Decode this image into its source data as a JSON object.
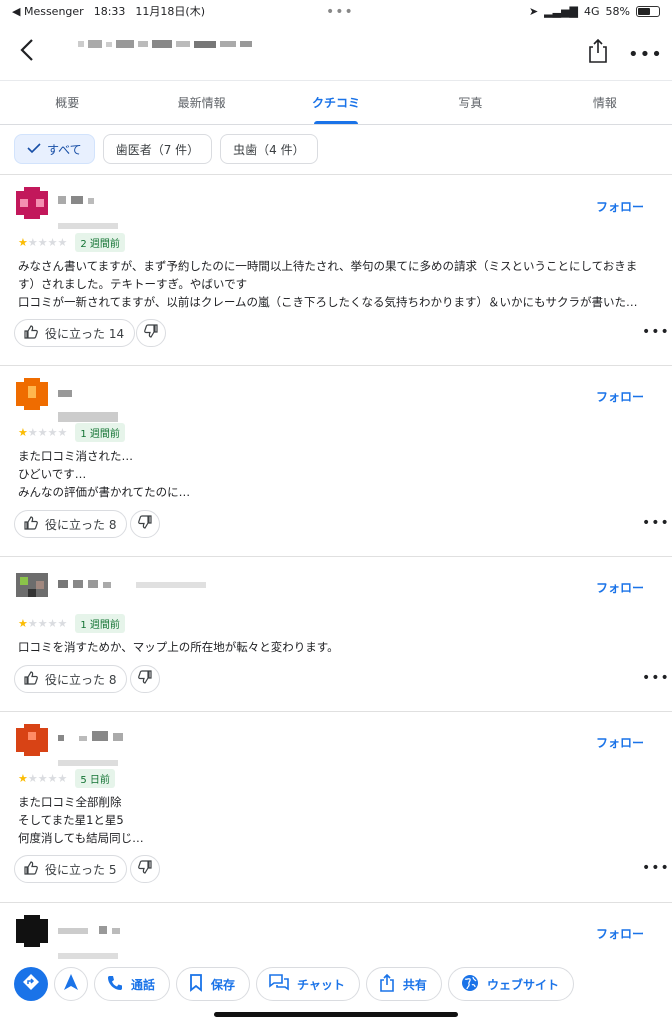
{
  "status_bar": {
    "back_app": "◀ Messenger",
    "time": "18:33",
    "date": "11月18日(木)",
    "center_dots": "•••",
    "network": "4G",
    "battery": "58%",
    "battery_level": 0.58
  },
  "header": {
    "more_label": "•••"
  },
  "tabs": [
    {
      "label": "概要"
    },
    {
      "label": "最新情報"
    },
    {
      "label": "クチコミ",
      "active": true
    },
    {
      "label": "写真"
    },
    {
      "label": "情報"
    }
  ],
  "filters": [
    {
      "label": "すべて",
      "selected": true
    },
    {
      "label": "歯医者（7 件）"
    },
    {
      "label": "虫歯（4 件）"
    }
  ],
  "follow_label": "フォロー",
  "more_label": "•••",
  "reviews": [
    {
      "rating": 1,
      "date": "2 週間前",
      "lines": [
        "みなさん書いてますが、まず予約したのに一時間以上待たされ、挙句の果てに多めの請求（ミスということにしておきま",
        "す）されました。テキトーすぎ。やばいです",
        "口コミが一新されてますが、以前はクレームの嵐（こき下ろしたくなる気持ちわかります）＆いかにもサクラが書いた…"
      ],
      "helpful": "役に立った 14",
      "avatar_color": "#c2185b"
    },
    {
      "rating": 1,
      "date": "1 週間前",
      "lines": [
        "また口コミ消された…",
        "ひどいです…",
        "みんなの評価が書かれてたのに…"
      ],
      "helpful": "役に立った 8",
      "avatar_color": "#ef6c00"
    },
    {
      "rating": 1,
      "date": "1 週間前",
      "lines": [
        "口コミを消すためか、マップ上の所在地が転々と変わります。"
      ],
      "helpful": "役に立った 8",
      "avatar_color": "#555555"
    },
    {
      "rating": 1,
      "date": "5 日前",
      "lines": [
        "また口コミ全部削除",
        "そしてまた星1と星5",
        "何度消しても結局同じ…"
      ],
      "helpful": "役に立った 5",
      "avatar_color": "#d84315"
    },
    {
      "avatar_color": "#111111"
    }
  ],
  "actions": [
    {
      "label": "通話",
      "icon": "phone-icon"
    },
    {
      "label": "保存",
      "icon": "bookmark-icon"
    },
    {
      "label": "チャット",
      "icon": "chat-icon"
    },
    {
      "label": "共有",
      "icon": "share-icon"
    },
    {
      "label": "ウェブサイト",
      "icon": "globe-icon"
    }
  ]
}
